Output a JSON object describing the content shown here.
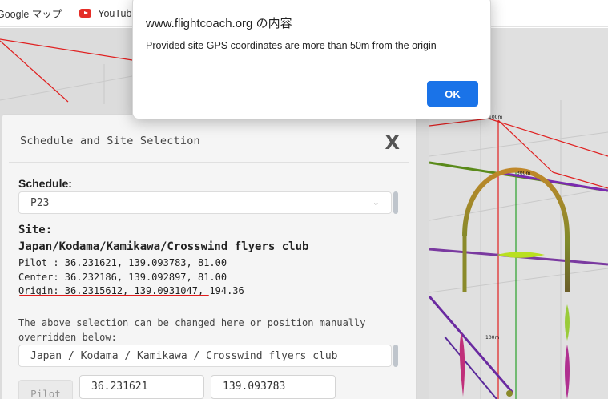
{
  "bookmarks": {
    "items": [
      {
        "label": "Google マップ"
      },
      {
        "label": "YouTube"
      }
    ]
  },
  "dialog": {
    "title": "www.flightcoach.org の内容",
    "message": "Provided site GPS coordinates are more than 50m from the origin",
    "ok_label": "OK"
  },
  "panel": {
    "title": "Schedule and Site Selection",
    "close_label": "X",
    "schedule_label": "Schedule:",
    "schedule_value": "P23",
    "site_label": "Site:",
    "site_name": "Japan/Kodama/Kamikawa/Crosswind flyers club",
    "pilot_line": "Pilot : 36.231621, 139.093783, 81.00",
    "center_line": "Center: 36.232186, 139.092897, 81.00",
    "origin_line": "Origin: 36.2315612, 139.0931047, 194.36",
    "note_line1": "The above selection can be changed here or position manually",
    "note_line2": "overridden below:",
    "site_select_value": "Japan / Kodama / Kamikawa / Crosswind flyers club",
    "pilot_button": "Pilot",
    "pilot_lat": "36.231621",
    "pilot_lon": "139.093783"
  },
  "viewer": {
    "markers": [
      "100m",
      "300m",
      "100m"
    ]
  },
  "colors": {
    "accent": "#1a73e8",
    "underline": "#e01b1b",
    "flightpath_start": "#c0882a",
    "flightpath_end": "#7a3aa0"
  }
}
